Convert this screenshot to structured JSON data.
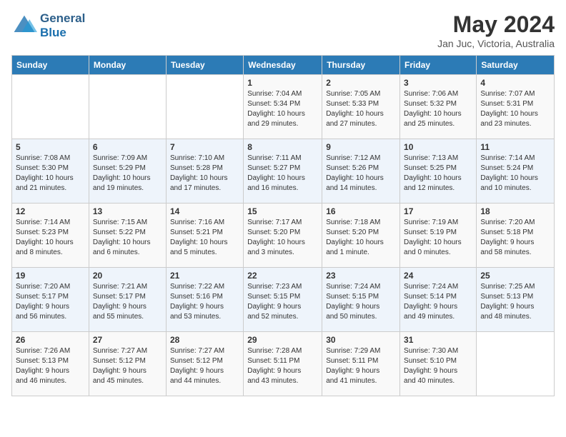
{
  "logo": {
    "line1": "General",
    "line2": "Blue"
  },
  "title": "May 2024",
  "subtitle": "Jan Juc, Victoria, Australia",
  "headers": [
    "Sunday",
    "Monday",
    "Tuesday",
    "Wednesday",
    "Thursday",
    "Friday",
    "Saturday"
  ],
  "weeks": [
    [
      {
        "day": "",
        "info": ""
      },
      {
        "day": "",
        "info": ""
      },
      {
        "day": "",
        "info": ""
      },
      {
        "day": "1",
        "info": "Sunrise: 7:04 AM\nSunset: 5:34 PM\nDaylight: 10 hours\nand 29 minutes."
      },
      {
        "day": "2",
        "info": "Sunrise: 7:05 AM\nSunset: 5:33 PM\nDaylight: 10 hours\nand 27 minutes."
      },
      {
        "day": "3",
        "info": "Sunrise: 7:06 AM\nSunset: 5:32 PM\nDaylight: 10 hours\nand 25 minutes."
      },
      {
        "day": "4",
        "info": "Sunrise: 7:07 AM\nSunset: 5:31 PM\nDaylight: 10 hours\nand 23 minutes."
      }
    ],
    [
      {
        "day": "5",
        "info": "Sunrise: 7:08 AM\nSunset: 5:30 PM\nDaylight: 10 hours\nand 21 minutes."
      },
      {
        "day": "6",
        "info": "Sunrise: 7:09 AM\nSunset: 5:29 PM\nDaylight: 10 hours\nand 19 minutes."
      },
      {
        "day": "7",
        "info": "Sunrise: 7:10 AM\nSunset: 5:28 PM\nDaylight: 10 hours\nand 17 minutes."
      },
      {
        "day": "8",
        "info": "Sunrise: 7:11 AM\nSunset: 5:27 PM\nDaylight: 10 hours\nand 16 minutes."
      },
      {
        "day": "9",
        "info": "Sunrise: 7:12 AM\nSunset: 5:26 PM\nDaylight: 10 hours\nand 14 minutes."
      },
      {
        "day": "10",
        "info": "Sunrise: 7:13 AM\nSunset: 5:25 PM\nDaylight: 10 hours\nand 12 minutes."
      },
      {
        "day": "11",
        "info": "Sunrise: 7:14 AM\nSunset: 5:24 PM\nDaylight: 10 hours\nand 10 minutes."
      }
    ],
    [
      {
        "day": "12",
        "info": "Sunrise: 7:14 AM\nSunset: 5:23 PM\nDaylight: 10 hours\nand 8 minutes."
      },
      {
        "day": "13",
        "info": "Sunrise: 7:15 AM\nSunset: 5:22 PM\nDaylight: 10 hours\nand 6 minutes."
      },
      {
        "day": "14",
        "info": "Sunrise: 7:16 AM\nSunset: 5:21 PM\nDaylight: 10 hours\nand 5 minutes."
      },
      {
        "day": "15",
        "info": "Sunrise: 7:17 AM\nSunset: 5:20 PM\nDaylight: 10 hours\nand 3 minutes."
      },
      {
        "day": "16",
        "info": "Sunrise: 7:18 AM\nSunset: 5:20 PM\nDaylight: 10 hours\nand 1 minute."
      },
      {
        "day": "17",
        "info": "Sunrise: 7:19 AM\nSunset: 5:19 PM\nDaylight: 10 hours\nand 0 minutes."
      },
      {
        "day": "18",
        "info": "Sunrise: 7:20 AM\nSunset: 5:18 PM\nDaylight: 9 hours\nand 58 minutes."
      }
    ],
    [
      {
        "day": "19",
        "info": "Sunrise: 7:20 AM\nSunset: 5:17 PM\nDaylight: 9 hours\nand 56 minutes."
      },
      {
        "day": "20",
        "info": "Sunrise: 7:21 AM\nSunset: 5:17 PM\nDaylight: 9 hours\nand 55 minutes."
      },
      {
        "day": "21",
        "info": "Sunrise: 7:22 AM\nSunset: 5:16 PM\nDaylight: 9 hours\nand 53 minutes."
      },
      {
        "day": "22",
        "info": "Sunrise: 7:23 AM\nSunset: 5:15 PM\nDaylight: 9 hours\nand 52 minutes."
      },
      {
        "day": "23",
        "info": "Sunrise: 7:24 AM\nSunset: 5:15 PM\nDaylight: 9 hours\nand 50 minutes."
      },
      {
        "day": "24",
        "info": "Sunrise: 7:24 AM\nSunset: 5:14 PM\nDaylight: 9 hours\nand 49 minutes."
      },
      {
        "day": "25",
        "info": "Sunrise: 7:25 AM\nSunset: 5:13 PM\nDaylight: 9 hours\nand 48 minutes."
      }
    ],
    [
      {
        "day": "26",
        "info": "Sunrise: 7:26 AM\nSunset: 5:13 PM\nDaylight: 9 hours\nand 46 minutes."
      },
      {
        "day": "27",
        "info": "Sunrise: 7:27 AM\nSunset: 5:12 PM\nDaylight: 9 hours\nand 45 minutes."
      },
      {
        "day": "28",
        "info": "Sunrise: 7:27 AM\nSunset: 5:12 PM\nDaylight: 9 hours\nand 44 minutes."
      },
      {
        "day": "29",
        "info": "Sunrise: 7:28 AM\nSunset: 5:11 PM\nDaylight: 9 hours\nand 43 minutes."
      },
      {
        "day": "30",
        "info": "Sunrise: 7:29 AM\nSunset: 5:11 PM\nDaylight: 9 hours\nand 41 minutes."
      },
      {
        "day": "31",
        "info": "Sunrise: 7:30 AM\nSunset: 5:10 PM\nDaylight: 9 hours\nand 40 minutes."
      },
      {
        "day": "",
        "info": ""
      }
    ]
  ]
}
